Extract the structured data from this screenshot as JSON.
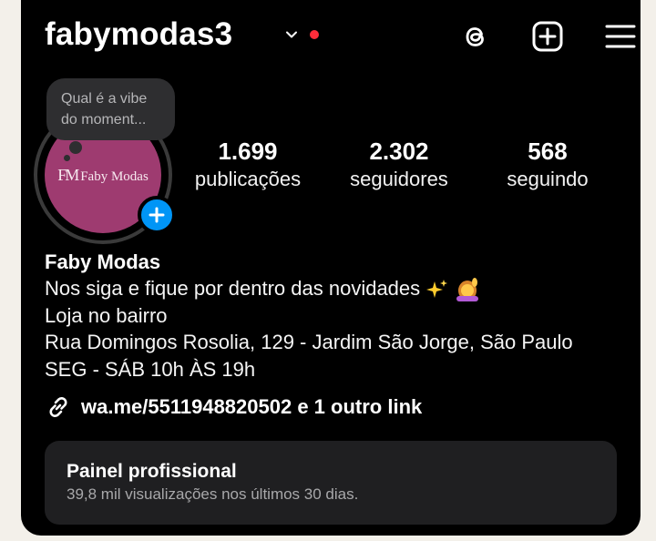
{
  "header": {
    "username": "fabymodas3",
    "icons": [
      "chevron-down-icon",
      "threads-icon",
      "add-content-icon",
      "menu-icon"
    ],
    "notification_color": "#ff2d3a"
  },
  "note": {
    "text": "Qual é a vibe do moment..."
  },
  "avatar": {
    "brand": "Faby Modas",
    "monogram": "FM",
    "background": "#9e3b70"
  },
  "stats": {
    "posts": {
      "value": "1.699",
      "label": "publicações"
    },
    "followers": {
      "value": "2.302",
      "label": "seguidores"
    },
    "following": {
      "value": "568",
      "label": "seguindo"
    }
  },
  "bio": {
    "name": "Faby Modas",
    "lines": [
      "Nos siga e fique por dentro das novidades",
      "Loja no bairro",
      "Rua Domingos Rosolia, 129 - Jardim São Jorge, São Paulo",
      "SEG - SÁB 10h ÀS 19h"
    ],
    "link": "wa.me/5511948820502 e 1 outro link"
  },
  "panel": {
    "title": "Painel profissional",
    "subtitle": "39,8 mil visualizações nos últimos 30 dias."
  },
  "colors": {
    "accent": "#0095f6",
    "panel_bg": "#1f1f21",
    "background": "#000000"
  }
}
